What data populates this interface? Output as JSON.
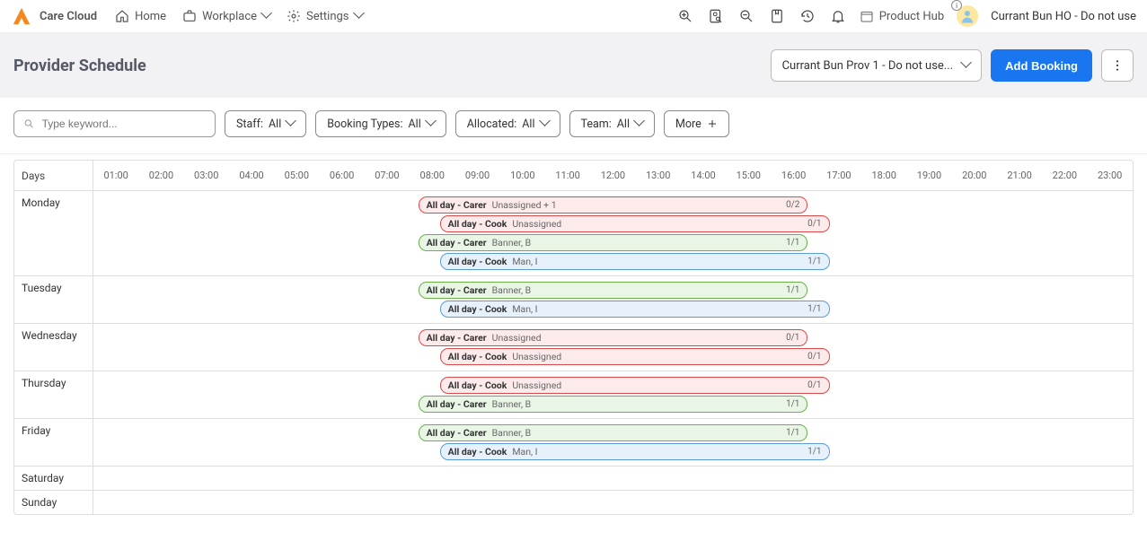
{
  "brand": "Care Cloud",
  "nav": {
    "home": "Home",
    "workplace": "Workplace",
    "settings": "Settings"
  },
  "product_hub": "Product Hub",
  "user_name": "Currant Bun HO - Do not use",
  "page_title": "Provider Schedule",
  "provider_selected": "Currant Bun Prov 1 - Do not use...",
  "add_booking": "Add Booking",
  "search_placeholder": "Type keyword...",
  "filters": {
    "staff": {
      "label": "Staff:",
      "value": "All"
    },
    "booking_types": {
      "label": "Booking Types:",
      "value": "All"
    },
    "allocated": {
      "label": "Allocated:",
      "value": "All"
    },
    "team": {
      "label": "Team:",
      "value": "All"
    },
    "more": "More"
  },
  "days_header": "Days",
  "hours": [
    "01:00",
    "02:00",
    "03:00",
    "04:00",
    "05:00",
    "06:00",
    "07:00",
    "08:00",
    "09:00",
    "10:00",
    "11:00",
    "12:00",
    "13:00",
    "14:00",
    "15:00",
    "16:00",
    "17:00",
    "18:00",
    "19:00",
    "20:00",
    "21:00",
    "22:00",
    "23:00"
  ],
  "hour_width_pct": 4.1667,
  "rows": [
    {
      "day": "Monday",
      "bookings": [
        {
          "title": "All day - Carer",
          "sub": "Unassigned + 1",
          "count": "0/2",
          "color": "red",
          "start": 8,
          "end": 17
        },
        {
          "title": "All day - Cook",
          "sub": "Unassigned",
          "count": "0/1",
          "color": "red",
          "start": 8.5,
          "end": 17.5
        },
        {
          "title": "All day - Carer",
          "sub": "Banner, B",
          "count": "1/1",
          "color": "green",
          "start": 8,
          "end": 17
        },
        {
          "title": "All day - Cook",
          "sub": "Man, I",
          "count": "1/1",
          "color": "blue",
          "start": 8.5,
          "end": 17.5
        }
      ]
    },
    {
      "day": "Tuesday",
      "bookings": [
        {
          "title": "All day - Carer",
          "sub": "Banner, B",
          "count": "1/1",
          "color": "green",
          "start": 8,
          "end": 17
        },
        {
          "title": "All day - Cook",
          "sub": "Man, I",
          "count": "1/1",
          "color": "blue",
          "start": 8.5,
          "end": 17.5
        }
      ]
    },
    {
      "day": "Wednesday",
      "bookings": [
        {
          "title": "All day - Carer",
          "sub": "Unassigned",
          "count": "0/1",
          "color": "red",
          "start": 8,
          "end": 17
        },
        {
          "title": "All day - Cook",
          "sub": "Unassigned",
          "count": "0/1",
          "color": "red",
          "start": 8.5,
          "end": 17.5
        }
      ]
    },
    {
      "day": "Thursday",
      "bookings": [
        {
          "title": "All day - Cook",
          "sub": "Unassigned",
          "count": "0/1",
          "color": "red",
          "start": 8.5,
          "end": 17.5
        },
        {
          "title": "All day - Carer",
          "sub": "Banner, B",
          "count": "1/1",
          "color": "green",
          "start": 8,
          "end": 17
        }
      ]
    },
    {
      "day": "Friday",
      "bookings": [
        {
          "title": "All day - Carer",
          "sub": "Banner, B",
          "count": "1/1",
          "color": "green",
          "start": 8,
          "end": 17
        },
        {
          "title": "All day - Cook",
          "sub": "Man, I",
          "count": "1/1",
          "color": "blue",
          "start": 8.5,
          "end": 17.5
        }
      ]
    },
    {
      "day": "Saturday",
      "bookings": []
    },
    {
      "day": "Sunday",
      "bookings": []
    }
  ]
}
